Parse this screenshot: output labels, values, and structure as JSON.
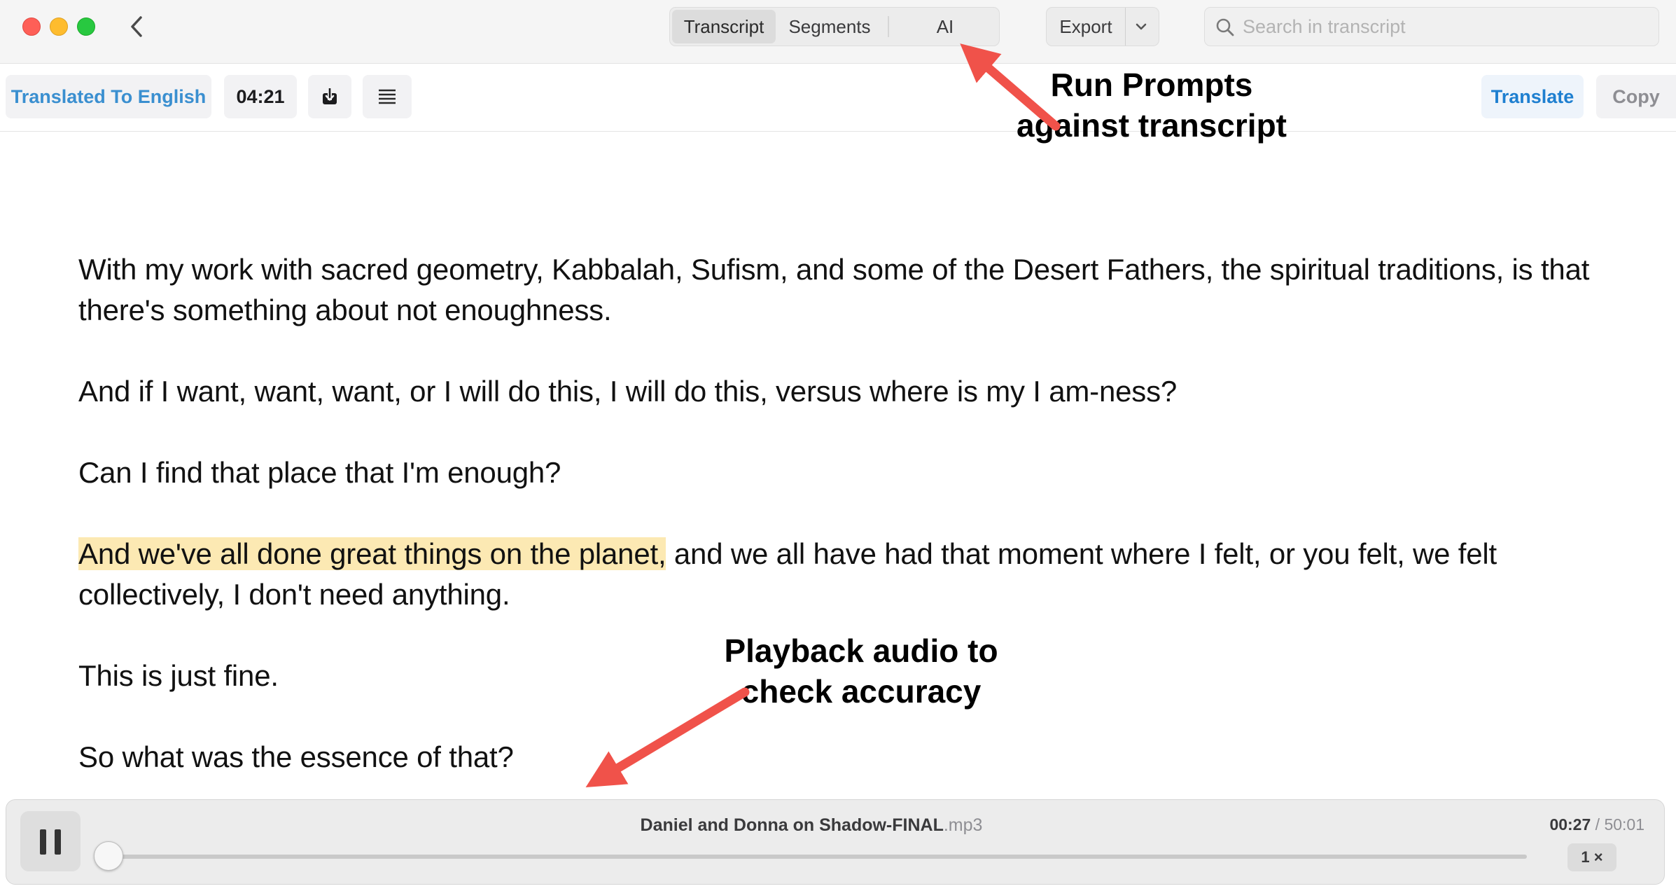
{
  "titlebar": {
    "tabs": [
      {
        "label": "Transcript",
        "active": true
      },
      {
        "label": "Segments",
        "active": false
      },
      {
        "label": "AI",
        "active": false
      }
    ],
    "export_label": "Export",
    "search": {
      "placeholder": "Search in transcript",
      "value": ""
    }
  },
  "toolbar": {
    "language_label": "Translated To English",
    "duration": "04:21",
    "translate_label": "Translate",
    "copy_label": "Copy"
  },
  "transcript": {
    "paragraphs": [
      {
        "highlight": "",
        "text": "With my work with sacred geometry, Kabbalah, Sufism, and some of the Desert Fathers, the spiritual traditions, is that there's something about not enoughness."
      },
      {
        "highlight": "",
        "text": "And if I want, want, want, or I will do this, I will do this, versus where is my I am-ness?"
      },
      {
        "highlight": "",
        "text": "Can I find that place that I'm enough?"
      },
      {
        "highlight": "And we've all done great things on the planet,",
        "text": " and we all have had that moment where I felt, or you felt, we felt collectively, I don't need anything."
      },
      {
        "highlight": "",
        "text": "This is just fine."
      },
      {
        "highlight": "",
        "text": "So what was the essence of that?"
      }
    ]
  },
  "annotations": {
    "top": "Run Prompts against transcript",
    "bottom": "Playback audio to check accuracy",
    "arrow_color": "#f0524a"
  },
  "player": {
    "file_name": "Daniel and Donna on Shadow-FINAL",
    "file_ext": ".mp3",
    "current_time": "00:27",
    "separator": " / ",
    "total_time": "50:01",
    "speed": "1 ×",
    "progress": 0.009
  },
  "colors": {
    "accent": "#2f7fe0",
    "highlight": "#fce9b3",
    "language_link": "#3a8fd0"
  },
  "icons": [
    "back-chevron-icon",
    "chevron-down-icon",
    "search-icon",
    "download-icon",
    "list-icon",
    "pause-icon"
  ]
}
